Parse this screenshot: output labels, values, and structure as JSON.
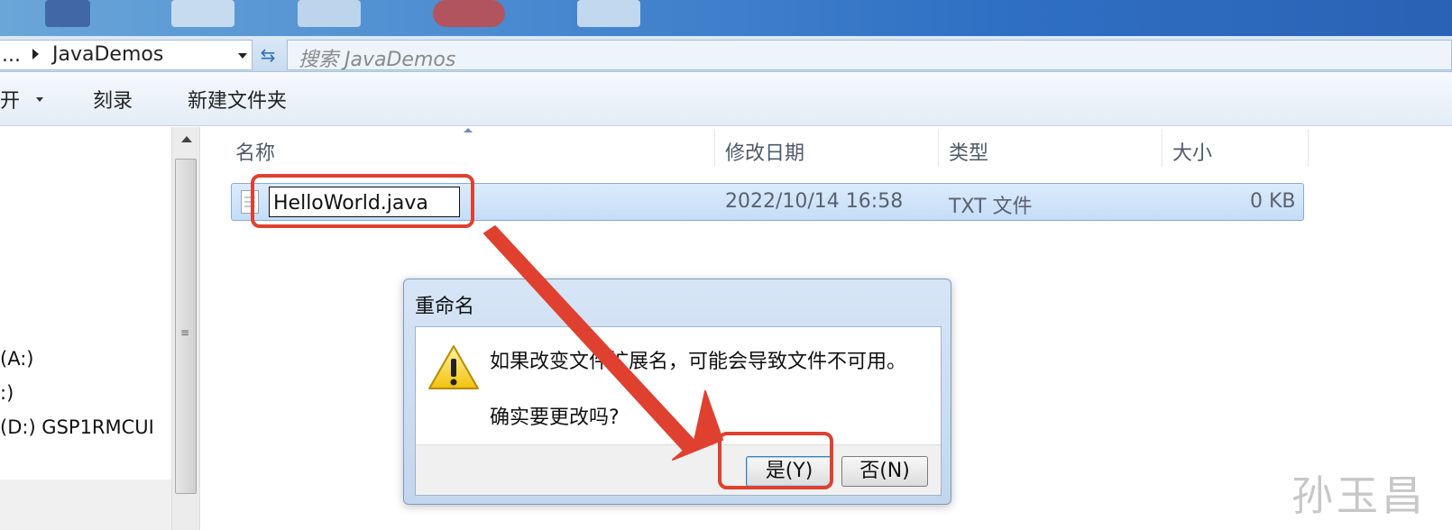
{
  "address_bar": {
    "ellipsis": "...",
    "path": "JavaDemos",
    "search_placeholder": "搜索 JavaDemos"
  },
  "toolbar": {
    "open_label": "开",
    "burn_label": "刻录",
    "new_folder_label": "新建文件夹"
  },
  "nav_pane": {
    "items": [
      "(A:)",
      ":)",
      "(D:) GSP1RMCUI"
    ]
  },
  "file_list": {
    "columns": [
      "名称",
      "修改日期",
      "类型",
      "大小"
    ],
    "rows": [
      {
        "name": "HelloWorld.java",
        "modified": "2022/10/14 16:58",
        "type": "TXT 文件",
        "size": "0 KB"
      }
    ]
  },
  "dialog": {
    "title": "重命名",
    "message": "如果改变文件扩展名，可能会导致文件不可用。",
    "question": "确实要更改吗?",
    "yes_label": "是(Y)",
    "no_label": "否(N)"
  },
  "watermark": "孙玉昌",
  "colors": {
    "annotation_red": "#e0402f",
    "selection_blue": "#cfe3fa",
    "dialog_frame": "#c8daf0"
  }
}
